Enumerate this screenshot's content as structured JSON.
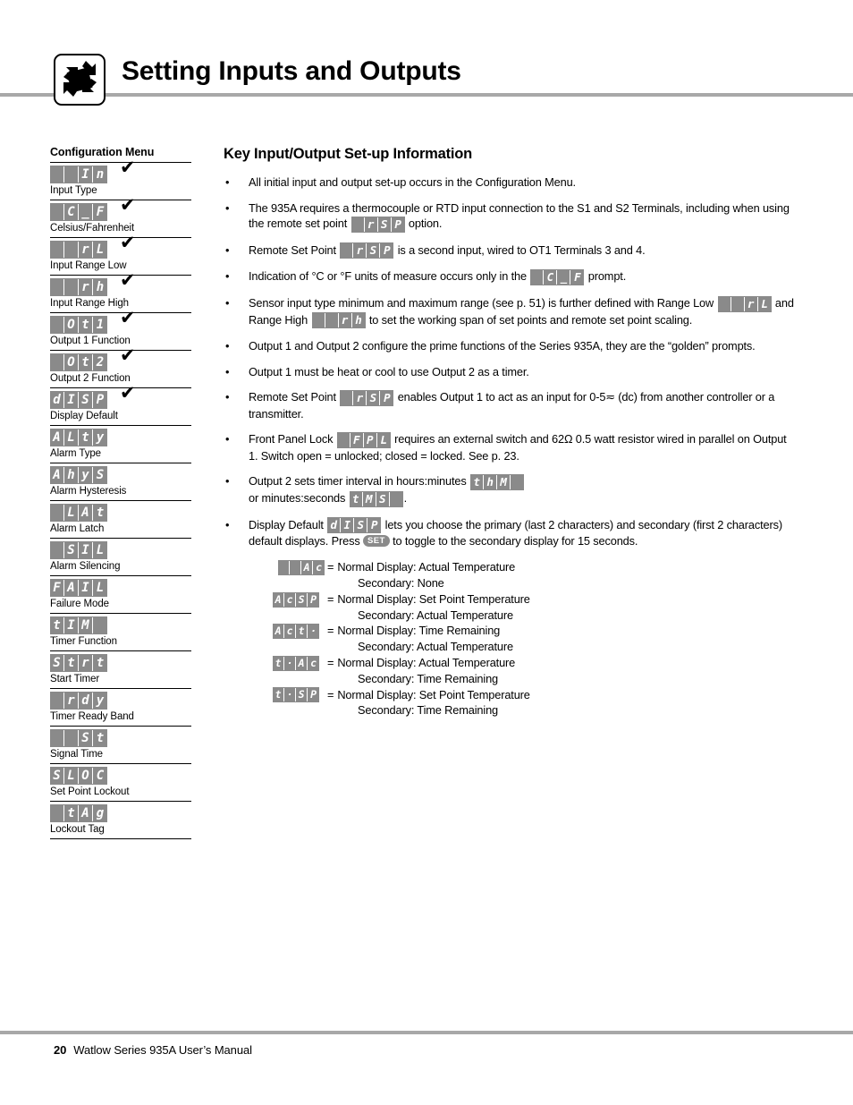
{
  "header": {
    "title": "Setting Inputs and Outputs",
    "icon": "rotating-square-arrows-icon"
  },
  "sidebar": {
    "title": "Configuration Menu",
    "items": [
      {
        "code": [
          "",
          "",
          "I",
          "n"
        ],
        "label": "Input Type",
        "check": true
      },
      {
        "code": [
          "",
          "C",
          "_",
          "F"
        ],
        "label": "Celsius/Fahrenheit",
        "check": true
      },
      {
        "code": [
          "",
          "",
          "r",
          "L"
        ],
        "label": "Input Range Low",
        "check": true
      },
      {
        "code": [
          "",
          "",
          "r",
          "h"
        ],
        "label": "Input Range High",
        "check": true
      },
      {
        "code": [
          "",
          "O",
          "t",
          "1"
        ],
        "label": "Output 1 Function",
        "check": true
      },
      {
        "code": [
          "",
          "O",
          "t",
          "2"
        ],
        "label": "Output 2 Function",
        "check": true
      },
      {
        "code": [
          "d",
          "I",
          "S",
          "P"
        ],
        "label": "Display Default",
        "check": true
      },
      {
        "code": [
          "A",
          "L",
          "t",
          "y"
        ],
        "label": "Alarm Type",
        "check": false
      },
      {
        "code": [
          "A",
          "h",
          "y",
          "S"
        ],
        "label": "Alarm Hysteresis",
        "check": false
      },
      {
        "code": [
          "",
          "L",
          "A",
          "t"
        ],
        "label": "Alarm Latch",
        "check": false
      },
      {
        "code": [
          "",
          "S",
          "I",
          "L"
        ],
        "label": "Alarm Silencing",
        "check": false
      },
      {
        "code": [
          "F",
          "A",
          "I",
          "L"
        ],
        "label": "Failure Mode",
        "check": false
      },
      {
        "code": [
          "t",
          "I",
          "M",
          ""
        ],
        "label": "Timer Function",
        "check": false
      },
      {
        "code": [
          "S",
          "t",
          "r",
          "t"
        ],
        "label": "Start Timer",
        "check": false
      },
      {
        "code": [
          "",
          "r",
          "d",
          "y"
        ],
        "label": "Timer Ready Band",
        "check": false
      },
      {
        "code": [
          "",
          "",
          "S",
          "t"
        ],
        "label": "Signal Time",
        "check": false
      },
      {
        "code": [
          "S",
          "L",
          "O",
          "C"
        ],
        "label": "Set Point Lockout",
        "check": false
      },
      {
        "code": [
          "",
          "t",
          "A",
          "g"
        ],
        "label": "Lockout Tag",
        "check": false
      }
    ]
  },
  "main": {
    "title": "Key Input/Output Set-up Information",
    "bullet_char": "•",
    "bullets": [
      {
        "id": "bullet-config-menu",
        "parts": [
          {
            "type": "text",
            "value": "All initial input and output set-up occurs in the Configuration Menu."
          }
        ]
      },
      {
        "id": "bullet-thermocouple-rtd",
        "parts": [
          {
            "type": "text",
            "value": "The 935A requires a thermocouple or RTD input connection to the S1 and S2 Terminals, including when using the remote set point "
          },
          {
            "type": "lcd",
            "value": [
              "",
              "r",
              "S",
              "P"
            ]
          },
          {
            "type": "text",
            "value": " option."
          }
        ]
      },
      {
        "id": "bullet-remote-set-point-input",
        "parts": [
          {
            "type": "text",
            "value": "Remote Set Point "
          },
          {
            "type": "lcd",
            "value": [
              "",
              "r",
              "S",
              "P"
            ]
          },
          {
            "type": "text",
            "value": " is a second input, wired to OT1 Terminals 3 and 4."
          }
        ]
      },
      {
        "id": "bullet-celsius-fahrenheit",
        "parts": [
          {
            "type": "text",
            "value": "Indication of °C or °F units of measure occurs only in the "
          },
          {
            "type": "lcd",
            "value": [
              "",
              "C",
              "_",
              "F"
            ]
          },
          {
            "type": "text",
            "value": " prompt."
          }
        ]
      },
      {
        "id": "bullet-sensor-range",
        "parts": [
          {
            "type": "text",
            "value": "Sensor input type minimum and maximum range (see p. 51) is further defined with Range Low "
          },
          {
            "type": "lcd",
            "value": [
              "",
              "",
              "r",
              "L"
            ]
          },
          {
            "type": "text",
            "value": " and Range High "
          },
          {
            "type": "lcd",
            "value": [
              "",
              "",
              "r",
              "h"
            ]
          },
          {
            "type": "text",
            "value": " to set the working span of set points and remote set point scaling."
          }
        ]
      },
      {
        "id": "bullet-golden-prompts",
        "parts": [
          {
            "type": "text",
            "value": "Output 1 and Output 2 configure the prime functions of the Series 935A, they are the “golden” prompts."
          }
        ]
      },
      {
        "id": "bullet-output1-heat-cool",
        "parts": [
          {
            "type": "text",
            "value": "Output 1 must be heat or cool to use Output 2 as a timer."
          }
        ]
      },
      {
        "id": "bullet-remote-set-point-enable",
        "parts": [
          {
            "type": "text",
            "value": "Remote Set Point "
          },
          {
            "type": "lcd",
            "value": [
              "",
              "r",
              "S",
              "P"
            ]
          },
          {
            "type": "text",
            "value": " enables Output 1 to act as an input for 0-5≂ (dc) from another controller or a transmitter."
          }
        ]
      },
      {
        "id": "bullet-front-panel-lock",
        "parts": [
          {
            "type": "text",
            "value": "Front Panel Lock "
          },
          {
            "type": "lcd",
            "value": [
              "",
              "F",
              "P",
              "L"
            ]
          },
          {
            "type": "text",
            "value": " requires an external switch and 62Ω 0.5 watt resistor wired in parallel on Output 1. Switch open = unlocked; closed = locked. See p. 23."
          }
        ]
      },
      {
        "id": "bullet-timer-interval",
        "parts": [
          {
            "type": "text",
            "value": "Output 2 sets timer interval in hours:minutes "
          },
          {
            "type": "lcd",
            "value": [
              "t",
              "h",
              "M",
              ""
            ]
          },
          {
            "type": "text",
            "value": "\nor minutes:seconds "
          },
          {
            "type": "lcd",
            "value": [
              "t",
              "M",
              "S",
              ""
            ]
          },
          {
            "type": "text",
            "value": "."
          }
        ]
      },
      {
        "id": "bullet-display-default",
        "parts": [
          {
            "type": "text",
            "value": "Display Default "
          },
          {
            "type": "lcd",
            "value": [
              "d",
              "I",
              "S",
              "P"
            ]
          },
          {
            "type": "text",
            "value": " lets you choose the primary (last 2 characters) and secondary (first 2 characters) default displays. Press "
          },
          {
            "type": "setkey",
            "value": "SET"
          },
          {
            "type": "text",
            "value": " to toggle to the secondary display for 15 seconds."
          }
        ]
      }
    ],
    "display_defaults": {
      "equals": "=",
      "entries": [
        {
          "code": [
            "",
            "",
            "A",
            "c"
          ],
          "align": "right",
          "primary": "Normal Display: Actual Temperature",
          "secondary": "Secondary: None"
        },
        {
          "code": [
            "A",
            "c",
            "S",
            "P"
          ],
          "align": "left",
          "primary": "Normal Display: Set Point Temperature",
          "secondary": "Secondary: Actual Temperature"
        },
        {
          "code": [
            "A",
            "c",
            "t",
            "·"
          ],
          "align": "left",
          "primary": "Normal Display: Time Remaining",
          "secondary": "Secondary: Actual Temperature"
        },
        {
          "code": [
            "t",
            "·",
            "A",
            "c"
          ],
          "align": "left",
          "primary": "Normal Display: Actual Temperature",
          "secondary": "Secondary: Time Remaining"
        },
        {
          "code": [
            "t",
            "·",
            "S",
            "P"
          ],
          "align": "left",
          "primary": "Normal Display: Set Point Temperature",
          "secondary": "Secondary: Time Remaining"
        }
      ]
    }
  },
  "footer": {
    "page_number": "20",
    "text": "Watlow Series 935A User’s Manual"
  }
}
